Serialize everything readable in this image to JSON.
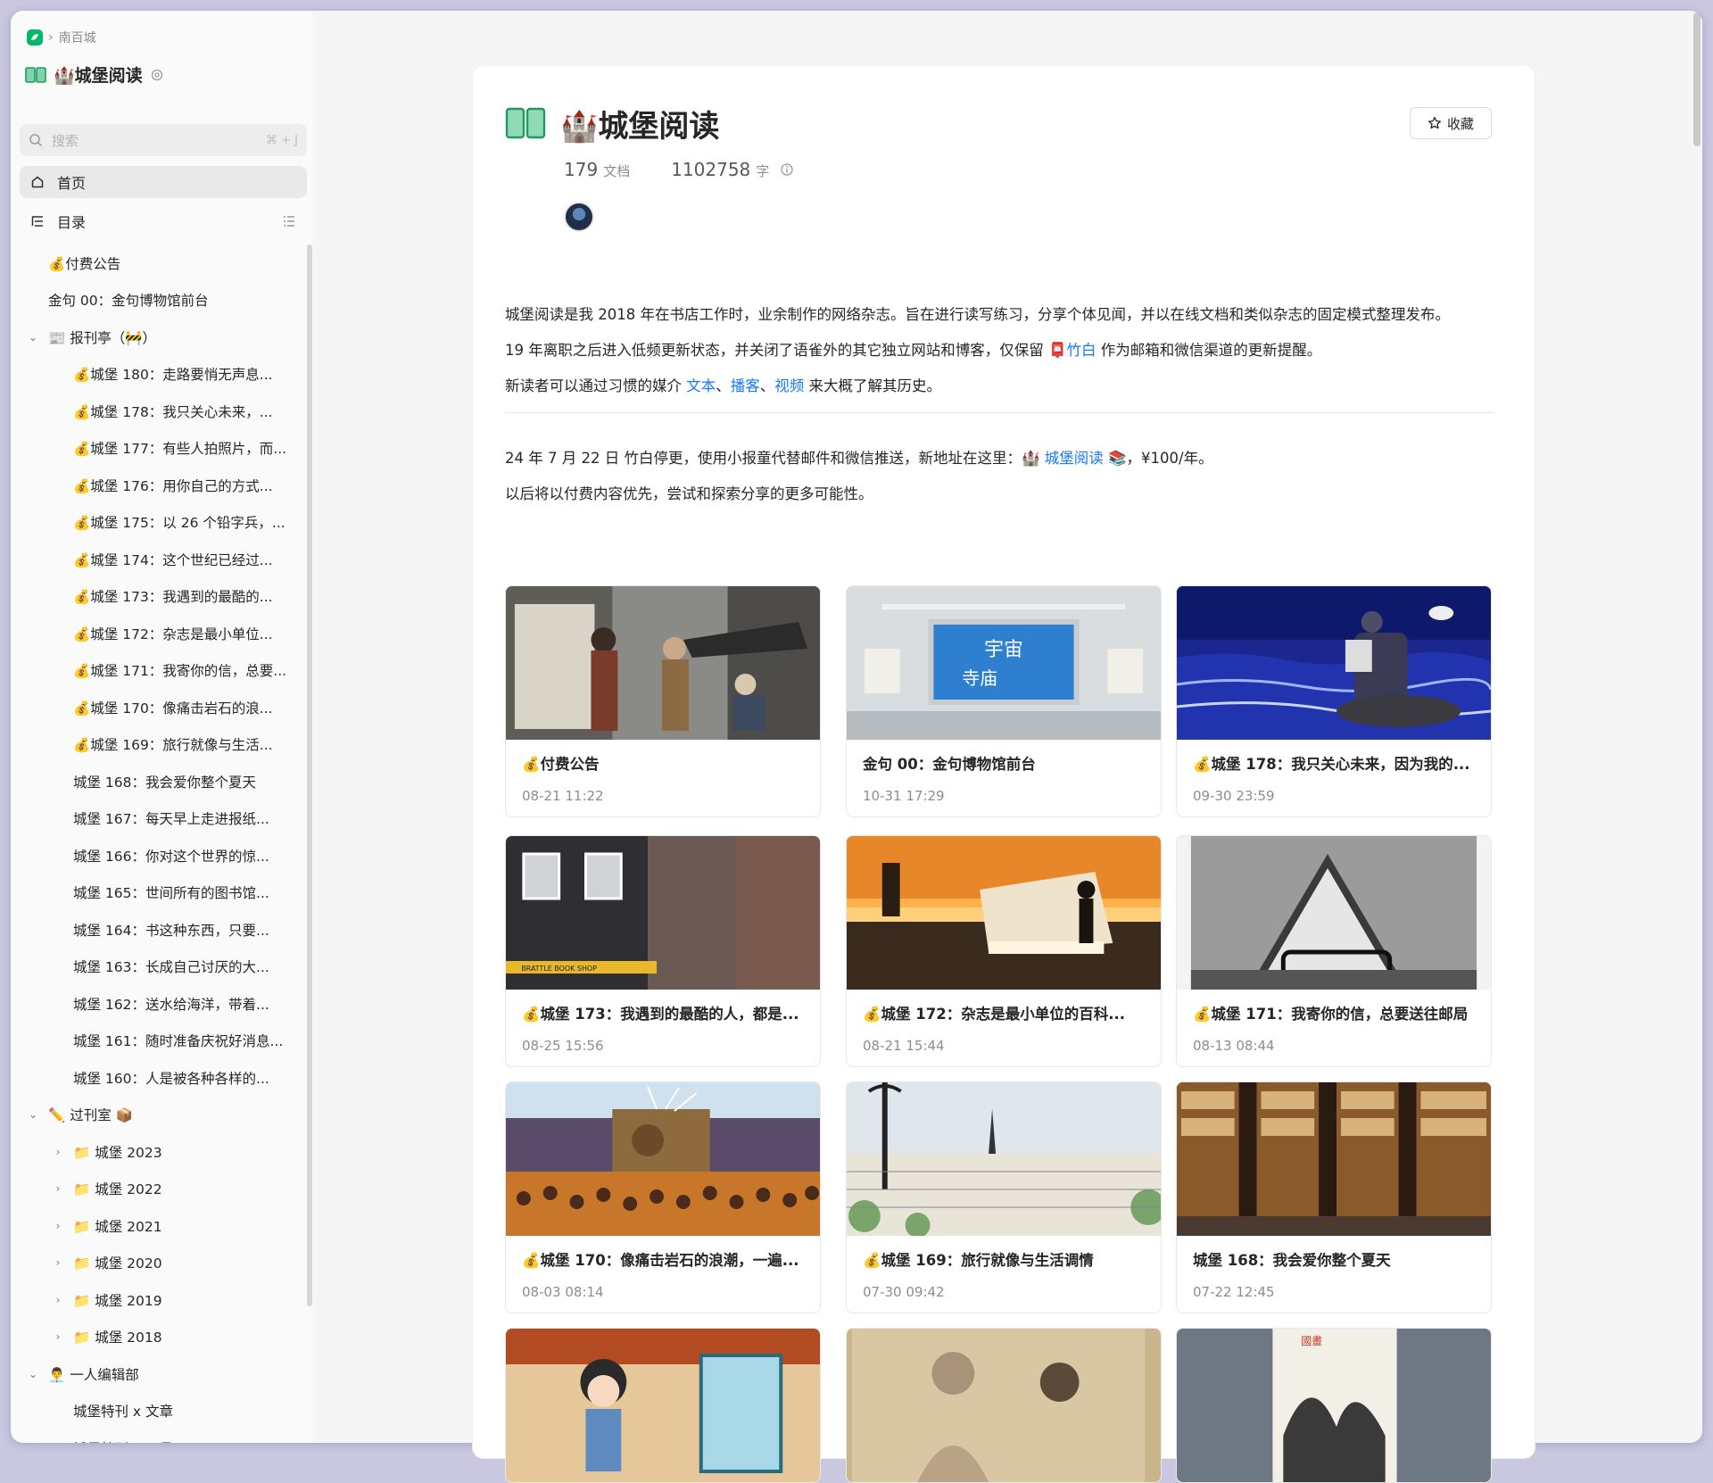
{
  "breadcrumb": {
    "parent": "南百城"
  },
  "sidebar": {
    "book_title": "🏰城堡阅读",
    "search_placeholder": "搜索",
    "search_shortcut": "⌘ + J",
    "home_label": "首页",
    "toc_label": "目录",
    "tree": [
      {
        "label": "💰付费公告",
        "level": "lvl0",
        "chev": ""
      },
      {
        "label": "金句 00：金句博物馆前台",
        "level": "lvl0",
        "chev": ""
      },
      {
        "label": "📰 报刊亭（🚧）",
        "level": "lvl0c",
        "chev": "⌄"
      },
      {
        "label": "💰城堡 180：走路要悄无声息...",
        "level": "lvl1",
        "chev": ""
      },
      {
        "label": "💰城堡 178：我只关心未来，...",
        "level": "lvl1",
        "chev": ""
      },
      {
        "label": "💰城堡 177：有些人拍照片，而...",
        "level": "lvl1",
        "chev": ""
      },
      {
        "label": "💰城堡 176：用你自己的方式...",
        "level": "lvl1",
        "chev": ""
      },
      {
        "label": "💰城堡 175：以 26 个铅字兵，...",
        "level": "lvl1",
        "chev": ""
      },
      {
        "label": "💰城堡 174：这个世纪已经过...",
        "level": "lvl1",
        "chev": ""
      },
      {
        "label": "💰城堡 173：我遇到的最酷的...",
        "level": "lvl1",
        "chev": ""
      },
      {
        "label": "💰城堡 172：杂志是最小单位...",
        "level": "lvl1",
        "chev": ""
      },
      {
        "label": "💰城堡 171：我寄你的信，总要...",
        "level": "lvl1",
        "chev": ""
      },
      {
        "label": "💰城堡 170：像痛击岩石的浪...",
        "level": "lvl1",
        "chev": ""
      },
      {
        "label": "💰城堡 169：旅行就像与生活...",
        "level": "lvl1",
        "chev": ""
      },
      {
        "label": "城堡 168：我会爱你整个夏天",
        "level": "lvl1",
        "chev": ""
      },
      {
        "label": "城堡 167：每天早上走进报纸...",
        "level": "lvl1",
        "chev": ""
      },
      {
        "label": "城堡 166：你对这个世界的惊...",
        "level": "lvl1",
        "chev": ""
      },
      {
        "label": "城堡 165：世间所有的图书馆...",
        "level": "lvl1",
        "chev": ""
      },
      {
        "label": "城堡 164：书这种东西，只要...",
        "level": "lvl1",
        "chev": ""
      },
      {
        "label": "城堡 163：长成自己讨厌的大...",
        "level": "lvl1",
        "chev": ""
      },
      {
        "label": "城堡 162：送水给海洋，带着...",
        "level": "lvl1",
        "chev": ""
      },
      {
        "label": "城堡 161：随时准备庆祝好消息...",
        "level": "lvl1",
        "chev": ""
      },
      {
        "label": "城堡 160：人是被各种各样的...",
        "level": "lvl1",
        "chev": ""
      },
      {
        "label": "✏️ 过刊室 📦",
        "level": "lvl0c",
        "chev": "⌄"
      },
      {
        "label": "📁 城堡 2023",
        "level": "lvl1c",
        "chev": "›"
      },
      {
        "label": "📁 城堡 2022",
        "level": "lvl1c",
        "chev": "›"
      },
      {
        "label": "📁 城堡 2021",
        "level": "lvl1c",
        "chev": "›"
      },
      {
        "label": "📁 城堡 2020",
        "level": "lvl1c",
        "chev": "›"
      },
      {
        "label": "📁 城堡 2019",
        "level": "lvl1c",
        "chev": "›"
      },
      {
        "label": "📁 城堡 2018",
        "level": "lvl1c",
        "chev": "›"
      },
      {
        "label": "👨‍💼 一人编辑部",
        "level": "lvl0c",
        "chev": "⌄"
      },
      {
        "label": "城堡特刊 x 文章",
        "level": "lvl1",
        "chev": ""
      },
      {
        "label": "城堡特刊 x 工具",
        "level": "lvl1",
        "chev": ""
      }
    ]
  },
  "main": {
    "title": "🏰城堡阅读",
    "favorite_label": "收藏",
    "doc_count": "179",
    "doc_unit": "文档",
    "word_count": "1102758",
    "word_unit": "字",
    "desc_line1": "城堡阅读是我 2018 年在书店工作时，业余制作的网络杂志。旨在进行读写练习，分享个体见闻，并以在线文档和类似杂志的固定模式整理发布。",
    "desc_line2_a": "19 年离职之后进入低频更新状态，并关闭了语雀外的其它独立网站和博客，仅保留 📮",
    "desc_line2_link": "竹白",
    "desc_line2_b": " 作为邮箱和微信渠道的更新提醒。",
    "desc_line3_a": "新读者可以通过习惯的媒介 ",
    "desc_line3_link1": "文本",
    "desc_line3_sep1": "、",
    "desc_line3_link2": "播客",
    "desc_line3_sep2": "、",
    "desc_line3_link3": "视频",
    "desc_line3_b": " 来大概了解其历史。",
    "notice_line1_a": "24 年 7 月 22 日 竹白停更，使用小报童代替邮件和微信推送，新地址在这里：🏰 ",
    "notice_line1_link": "城堡阅读",
    "notice_line1_b": " 📚，¥100/年。",
    "notice_line2": "以后将以付费内容优先，尝试和探索分享的更多可能性。"
  },
  "cards": [
    {
      "title": "💰付费公告",
      "date": "08-21 11:22",
      "thumb": "street"
    },
    {
      "title": "金句 00：金句博物馆前台",
      "date": "10-31 17:29",
      "thumb": "billboard"
    },
    {
      "title": "💰城堡 178：我只关心未来，因为我的...",
      "date": "09-30 23:59",
      "thumb": "sea"
    },
    {
      "title": "💰城堡 173：我遇到的最酷的人，都是...",
      "date": "08-25 15:56",
      "thumb": "building"
    },
    {
      "title": "💰城堡 172：杂志是最小单位的百科...",
      "date": "08-21 15:44",
      "thumb": "sunset"
    },
    {
      "title": "💰城堡 171：我寄你的信，总要送往邮局",
      "date": "08-13 08:44",
      "thumb": "book"
    },
    {
      "title": "💰城堡 170：像痛击岩石的浪潮，一遍...",
      "date": "08-03 08:14",
      "thumb": "festival"
    },
    {
      "title": "💰城堡 169：旅行就像与生活调情",
      "date": "07-30 09:42",
      "thumb": "paris"
    },
    {
      "title": "城堡 168：我会爱你整个夏天",
      "date": "07-22 12:45",
      "thumb": "library"
    },
    {
      "title": "",
      "date": "",
      "thumb": "anime"
    },
    {
      "title": "",
      "date": "",
      "thumb": "sketch"
    },
    {
      "title": "",
      "date": "",
      "thumb": "ink"
    }
  ],
  "colors": {
    "accent": "#00b96b",
    "link": "#1677ff"
  }
}
